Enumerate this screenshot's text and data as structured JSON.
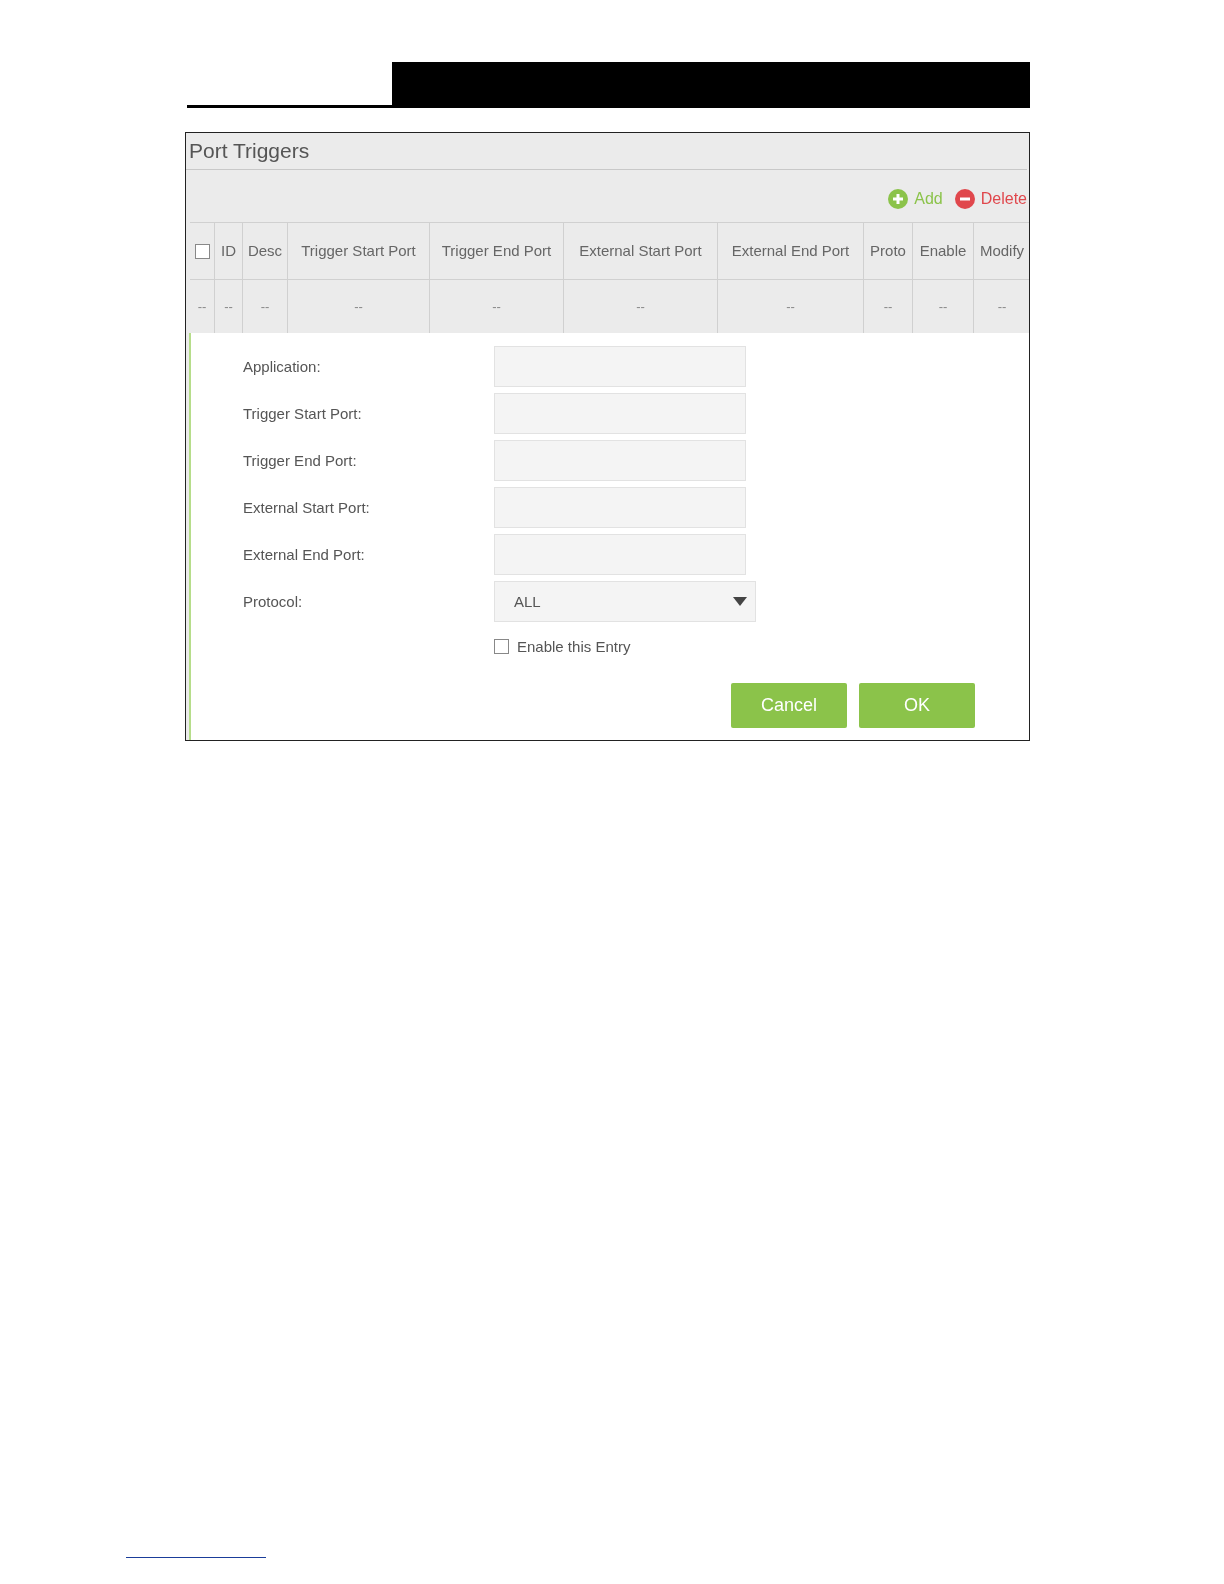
{
  "panel": {
    "title": "Port Triggers"
  },
  "toolbar": [
    {
      "kind": "add",
      "label": "Add"
    },
    {
      "kind": "delete",
      "label": "Delete"
    }
  ],
  "table": {
    "columns": [
      {
        "kind": "checkbox",
        "checked": false
      },
      {
        "kind": "text",
        "label": "ID"
      },
      {
        "kind": "text",
        "label": "Desc"
      },
      {
        "kind": "text",
        "label": "Trigger Start Port"
      },
      {
        "kind": "text",
        "label": "Trigger End Port"
      },
      {
        "kind": "text",
        "label": "External Start Port"
      },
      {
        "kind": "text",
        "label": "External End Port"
      },
      {
        "kind": "text",
        "label": "Proto"
      },
      {
        "kind": "text",
        "label": "Enable"
      },
      {
        "kind": "text",
        "label": "Modify"
      }
    ],
    "rows": [
      {
        "cells": [
          "--",
          "--",
          "--",
          "--",
          "--",
          "--",
          "--",
          "--",
          "--",
          "--"
        ]
      }
    ]
  },
  "form": {
    "fields": [
      {
        "kind": "text",
        "label": "Application:"
      },
      {
        "kind": "text",
        "label": "Trigger Start Port:"
      },
      {
        "kind": "text",
        "label": "Trigger End Port:"
      },
      {
        "kind": "text",
        "label": "External Start Port:"
      },
      {
        "kind": "text",
        "label": "External End Port:"
      },
      {
        "kind": "select",
        "label": "Protocol:",
        "value": "ALL"
      }
    ],
    "enable": {
      "label": "Enable this Entry",
      "checked": false
    },
    "buttons": [
      {
        "label": "Cancel"
      },
      {
        "label": "OK"
      }
    ]
  }
}
